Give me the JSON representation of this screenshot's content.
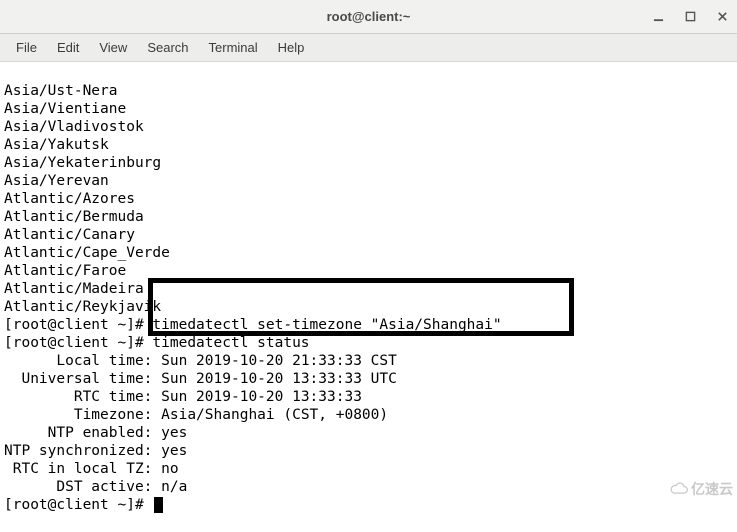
{
  "window": {
    "title": "root@client:~"
  },
  "menu": {
    "file": "File",
    "edit": "Edit",
    "view": "View",
    "search": "Search",
    "terminal": "Terminal",
    "help": "Help"
  },
  "terminal": {
    "lines": [
      "Asia/Ust-Nera",
      "Asia/Vientiane",
      "Asia/Vladivostok",
      "Asia/Yakutsk",
      "Asia/Yekaterinburg",
      "Asia/Yerevan",
      "Atlantic/Azores",
      "Atlantic/Bermuda",
      "Atlantic/Canary",
      "Atlantic/Cape_Verde",
      "Atlantic/Faroe",
      "Atlantic/Madeira",
      "Atlantic/Reykjavik"
    ],
    "cmd1_prompt": "[root@client ~]# ",
    "cmd1_text": "timedatectl set-timezone \"Asia/Shanghai\"",
    "cmd2_prompt": "[root@client ~]# ",
    "cmd2_text": "timedatectl status",
    "status": {
      "local_time_label": "      Local time: ",
      "local_time_value": "Sun 2019-10-20 21:33:33 CST",
      "universal_time_label": "  Universal time: ",
      "universal_time_value": "Sun 2019-10-20 13:33:33 UTC",
      "rtc_time_label": "        RTC time: ",
      "rtc_time_value": "Sun 2019-10-20 13:33:33",
      "timezone_label": "        Timezone: ",
      "timezone_value": "Asia/Shanghai (CST, +0800)",
      "ntp_enabled_label": "     NTP enabled: ",
      "ntp_enabled_value": "yes",
      "ntp_sync_label": "NTP synchronized: ",
      "ntp_sync_value": "yes",
      "rtc_local_label": " RTC in local TZ: ",
      "rtc_local_value": "no",
      "dst_active_label": "      DST active: ",
      "dst_active_value": "n/a"
    },
    "final_prompt": "[root@client ~]# "
  },
  "watermark": "亿速云"
}
